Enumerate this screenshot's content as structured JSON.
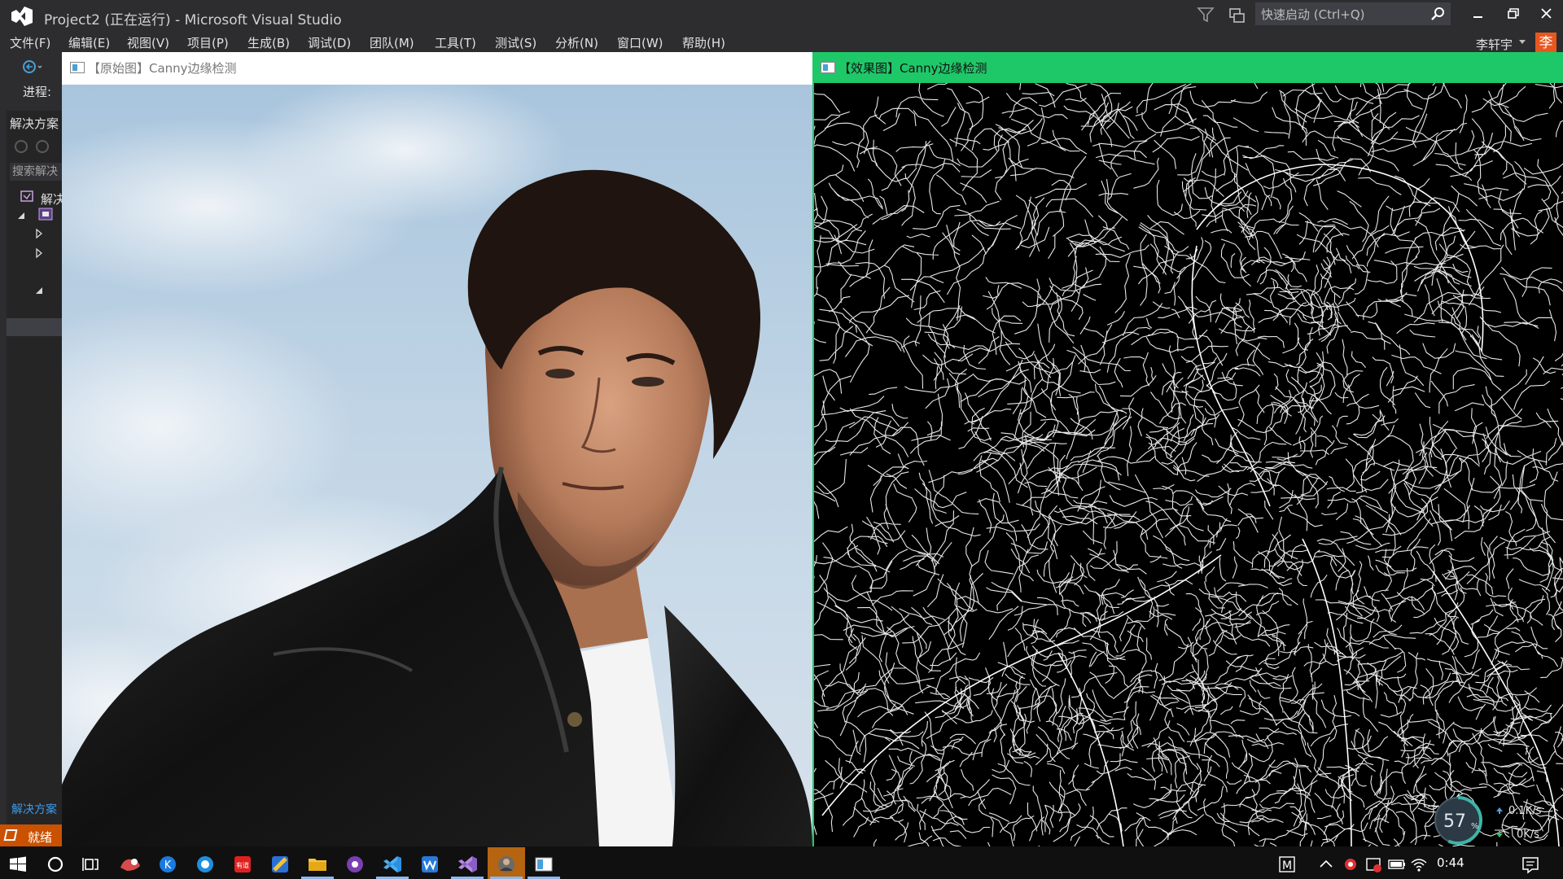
{
  "window": {
    "title": "Project2 (正在运行) - Microsoft Visual Studio",
    "quick_launch_placeholder": "快速启动 (Ctrl+Q)"
  },
  "menu": {
    "items": [
      {
        "label": "文件(F)"
      },
      {
        "label": "编辑(E)"
      },
      {
        "label": "视图(V)"
      },
      {
        "label": "项目(P)"
      },
      {
        "label": "生成(B)"
      },
      {
        "label": "调试(D)"
      },
      {
        "label": "团队(M)"
      },
      {
        "label": "工具(T)"
      },
      {
        "label": "测试(S)"
      },
      {
        "label": "分析(N)"
      },
      {
        "label": "窗口(W)"
      },
      {
        "label": "帮助(H)"
      }
    ],
    "user_name": "李轩宇",
    "user_avatar_text": "李"
  },
  "left_panel": {
    "progress_label": "进程:",
    "solution_explorer_title": "解决方案",
    "search_placeholder": "搜索解决",
    "root_item_label": "解决",
    "footer_tab": "解决方案"
  },
  "status_bar": {
    "text": "就绪"
  },
  "image_windows": {
    "original_title": "【原始图】Canny边缘检测",
    "result_title": "【效果图】Canny边缘检测",
    "result_titlebar_color": "#1ec868"
  },
  "network_widget": {
    "cpu_percent": "57",
    "cpu_unit": "%",
    "upload": "0.1K/s",
    "download": "0K/s"
  },
  "taskbar": {
    "clock": "0:44",
    "icons": [
      "windows-start-icon",
      "cortana-search-icon",
      "task-view-icon",
      "app-red-icon",
      "kugou-music-icon",
      "browser-icon",
      "youdao-dict-icon",
      "app-yellow-icon",
      "file-explorer-icon",
      "onenote-icon",
      "vscode-icon",
      "wps-icon",
      "visual-studio-icon",
      "opencv-window-icon",
      "photo-viewer-icon"
    ],
    "tray": [
      "ime-m-icon",
      "chevron-up-icon",
      "antivirus-icon",
      "security-center-icon",
      "battery-icon",
      "wifi-icon",
      "volume-icon",
      "notification-icon"
    ]
  },
  "colors": {
    "vs_chrome": "#2d2d30",
    "status_bar": "#ca5100",
    "user_avatar": "#e8571d"
  }
}
